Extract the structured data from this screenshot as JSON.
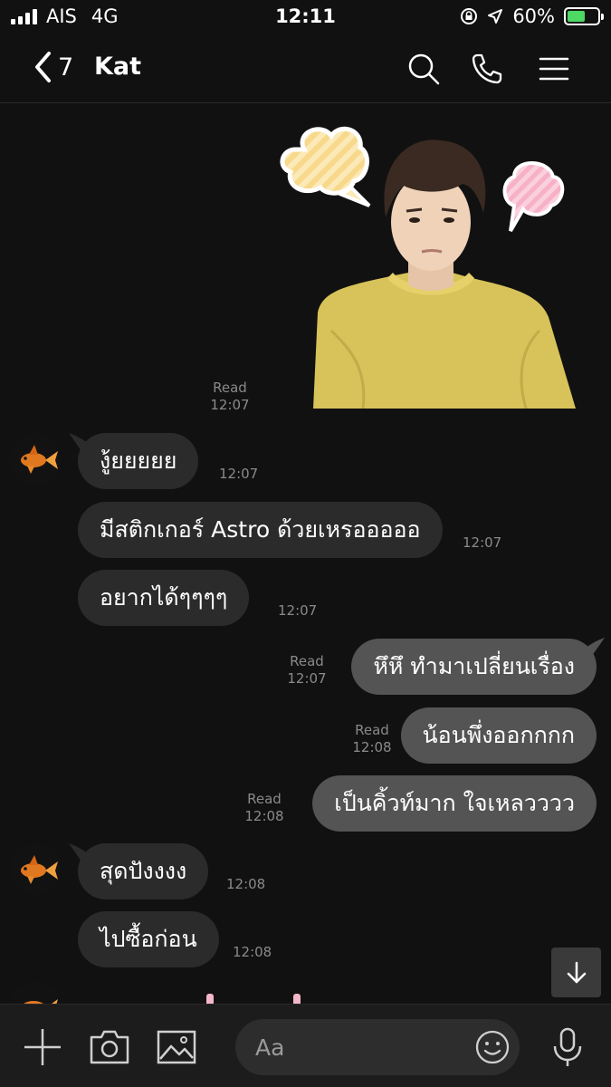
{
  "status_bar": {
    "carrier": "AIS",
    "network": "4G",
    "time": "12:11",
    "battery": "60%",
    "battery_level": 0.6
  },
  "header": {
    "back_count": "7",
    "title": "Kat",
    "icons": [
      "search-icon",
      "phone-icon",
      "menu-icon"
    ]
  },
  "messages": [
    {
      "id": "sticker",
      "dir": "out",
      "type": "sticker",
      "read": "Read",
      "time": "12:07"
    },
    {
      "id": "m1",
      "dir": "in",
      "text": "งู้ยยยยย",
      "time": "12:07"
    },
    {
      "id": "m2",
      "dir": "in",
      "text": "มีสติกเกอร์ Astro ด้วยเหรอออออ",
      "time": "12:07"
    },
    {
      "id": "m3",
      "dir": "in",
      "text": "อยากได้ๆๆๆๆ",
      "time": "12:07"
    },
    {
      "id": "m4",
      "dir": "out",
      "text": "หึหึ ทำมาเปลี่ยนเรื่อง",
      "read": "Read",
      "time": "12:07"
    },
    {
      "id": "m5",
      "dir": "out",
      "text": "น้อนพึ่งออกกกก",
      "read": "Read",
      "time": "12:08"
    },
    {
      "id": "m6",
      "dir": "out",
      "text": "เป็นคิ้วท์มาก ใจเหลวววว",
      "read": "Read",
      "time": "12:08"
    },
    {
      "id": "m7",
      "dir": "in",
      "text": "สุดปังงงง",
      "time": "12:08"
    },
    {
      "id": "m8",
      "dir": "in",
      "text": "ไปซื้อก่อน",
      "time": "12:08"
    }
  ],
  "composer": {
    "placeholder": "Aa",
    "icons": [
      "plus-icon",
      "camera-icon",
      "image-icon",
      "emoji-icon",
      "microphone-icon"
    ]
  },
  "colors": {
    "background": "#111111",
    "incoming_bubble": "#2b2b2b",
    "outgoing_bubble": "#545454",
    "battery_fill": "#4cd964",
    "sticker_shirt": "#d8c25a"
  }
}
